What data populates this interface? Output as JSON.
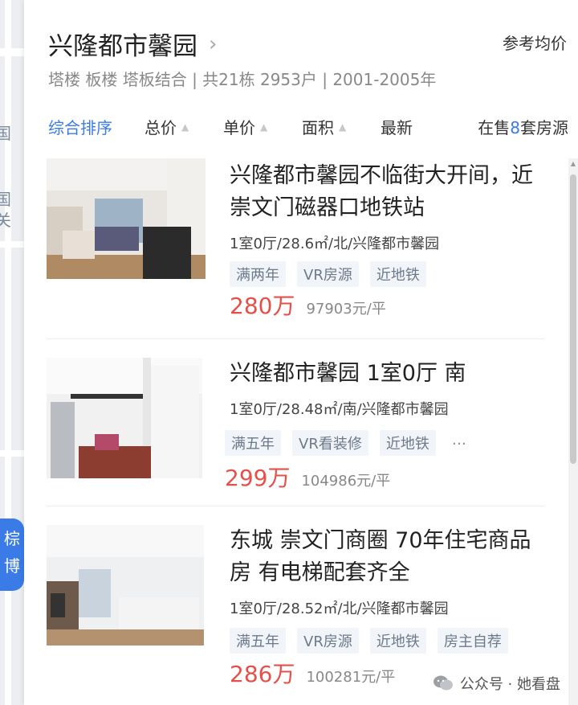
{
  "map": {
    "labels": [
      "国",
      "国",
      "关",
      "棕",
      "博"
    ]
  },
  "header": {
    "title": "兴隆都市馨园",
    "ref_price_label": "参考均价",
    "subtitle": "塔楼 板楼 塔板结合 | 共21栋 2953户 | 2001-2005年"
  },
  "sort_bar": {
    "items": [
      "综合排序",
      "总价",
      "单价",
      "面积",
      "最新"
    ],
    "on_sale_prefix": "在售",
    "on_sale_count": "8",
    "on_sale_suffix": "套房源"
  },
  "listings": [
    {
      "title": "兴隆都市馨园不临街大开间，近崇文门磁器口地铁站",
      "meta": "1室0厅/28.6㎡/北/兴隆都市馨园",
      "tags": [
        "满两年",
        "VR房源",
        "近地铁"
      ],
      "price": "280万",
      "unit_price": "97903元/平"
    },
    {
      "title": "兴隆都市馨园 1室0厅 南",
      "meta": "1室0厅/28.48㎡/南/兴隆都市馨园",
      "tags": [
        "满五年",
        "VR看装修",
        "近地铁"
      ],
      "more": "…",
      "price": "299万",
      "unit_price": "104986元/平"
    },
    {
      "title": "东城 崇文门商圈 70年住宅商品房 有电梯配套齐全",
      "meta": "1室0厅/28.52㎡/北/兴隆都市馨园",
      "tags": [
        "满五年",
        "VR房源",
        "近地铁",
        "房主自荐"
      ],
      "price": "286万",
      "unit_price": "100281元/平"
    }
  ],
  "watermark": {
    "text": "公众号 · 她看盘"
  },
  "colors": {
    "accent": "#3a7be8",
    "price": "#e5504a",
    "tag_bg": "#f1f4f8"
  }
}
